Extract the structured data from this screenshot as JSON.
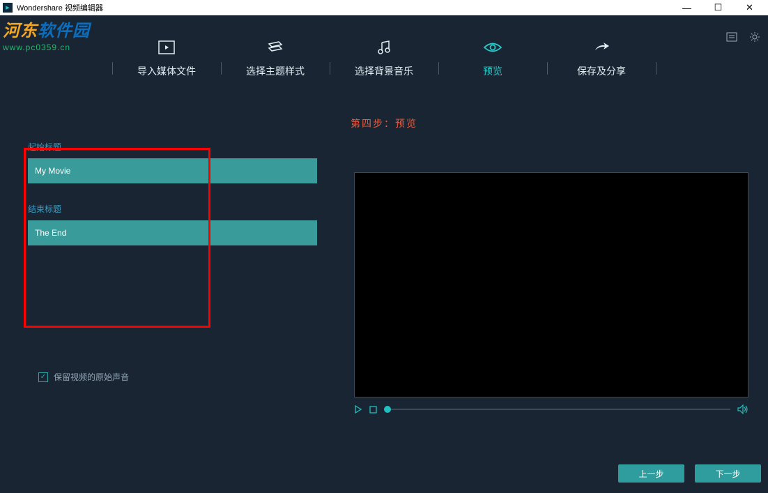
{
  "window": {
    "title": "Wondershare 视频编辑器"
  },
  "watermark": {
    "line1_a": "河东",
    "line1_b": "软件园",
    "line2": "www.pc0359.cn"
  },
  "tabs": [
    {
      "label": "导入媒体文件"
    },
    {
      "label": "选择主题样式"
    },
    {
      "label": "选择背景音乐"
    },
    {
      "label": "预览"
    },
    {
      "label": "保存及分享"
    }
  ],
  "step_heading": "第四步：预览",
  "form": {
    "start_label": "起始标题",
    "start_value": "My Movie",
    "end_label": "结束标题",
    "end_value": "The End"
  },
  "checkbox": {
    "checked": true,
    "label": "保留视频的原始声音"
  },
  "footer": {
    "prev": "上一步",
    "next": "下一步"
  },
  "colors": {
    "accent": "#23c8c8",
    "input_bg": "#3a9b9b",
    "step_text": "#e85a3e"
  }
}
